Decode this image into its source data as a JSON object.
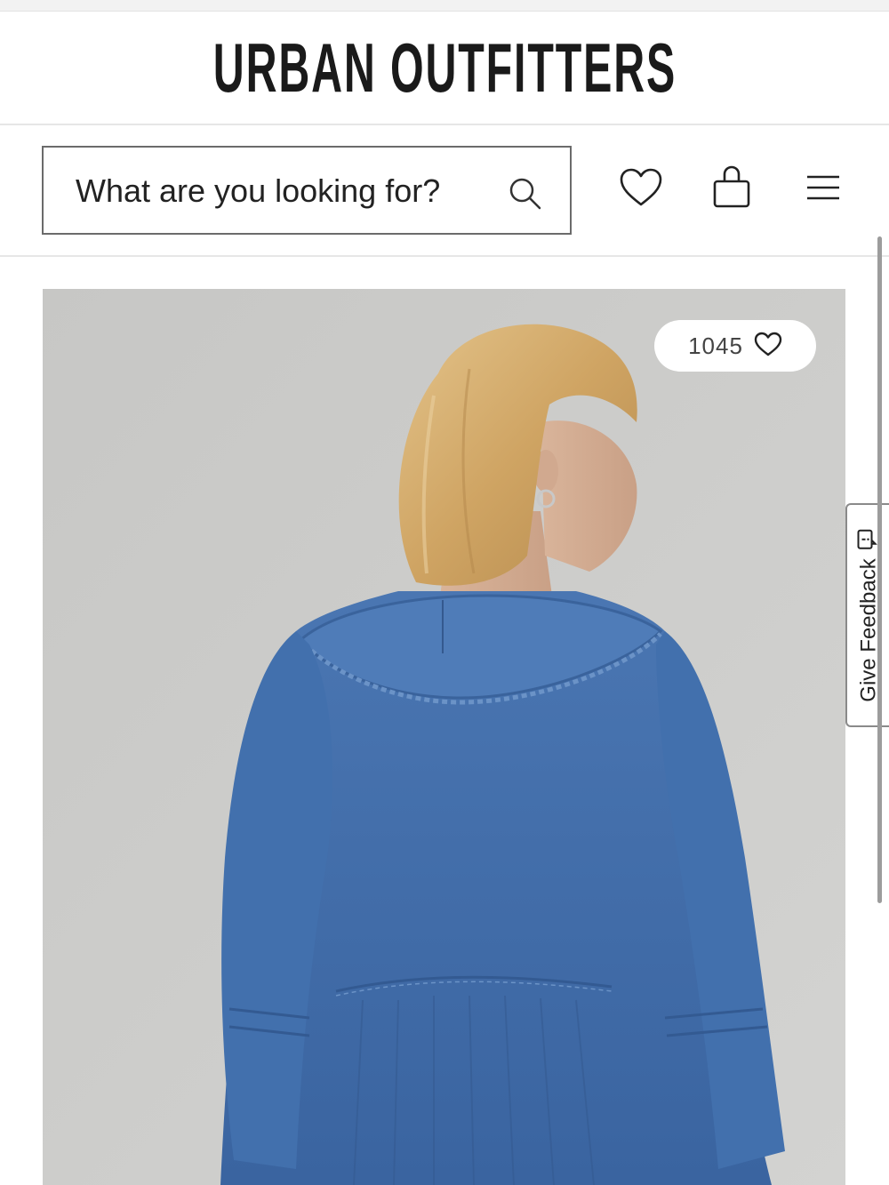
{
  "header": {
    "brand": "URBAN OUTFITTERS"
  },
  "search": {
    "placeholder": "What are you looking for?",
    "icon": "search-icon"
  },
  "header_actions": [
    {
      "name": "wishlist",
      "icon": "heart-icon"
    },
    {
      "name": "bag",
      "icon": "shopping-bag-icon"
    },
    {
      "name": "menu",
      "icon": "hamburger-menu-icon"
    }
  ],
  "product": {
    "like_count": "1045",
    "like_icon": "heart-icon"
  },
  "feedback": {
    "label": "Give Feedback",
    "icon": "feedback-icon"
  },
  "colors": {
    "text": "#1a1a1a",
    "divider": "#e6e6e6",
    "image_background": "#c9c9c7",
    "denim": "#3e6aa8"
  }
}
